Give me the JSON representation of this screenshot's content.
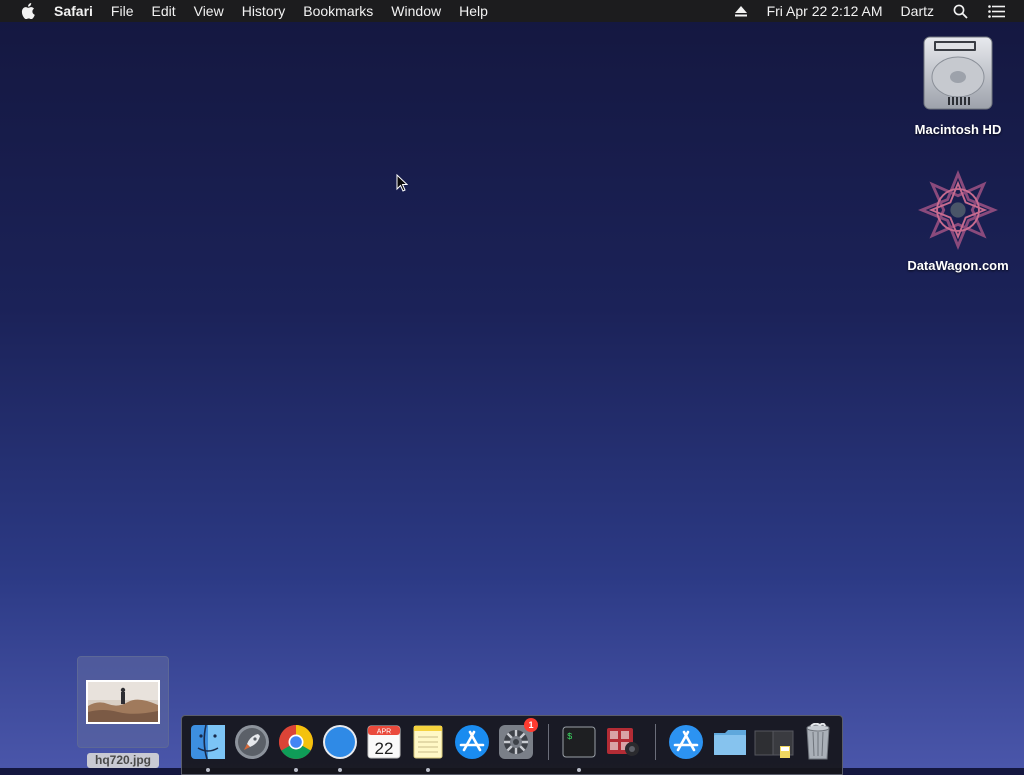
{
  "menubar": {
    "app_name": "Safari",
    "menus": [
      "File",
      "Edit",
      "View",
      "History",
      "Bookmarks",
      "Window",
      "Help"
    ],
    "clock": "Fri Apr 22  2:12 AM",
    "user": "Dartz"
  },
  "desktop": {
    "icons": [
      {
        "label": "Macintosh HD",
        "icon": "hard-drive-icon"
      },
      {
        "label": "DataWagon.com",
        "icon": "datawagon-logo-icon"
      }
    ],
    "file": {
      "label": "hq720.jpg",
      "icon": "image-thumbnail-icon"
    }
  },
  "dock": {
    "items": [
      {
        "name": "finder",
        "icon": "finder-icon",
        "running": true
      },
      {
        "name": "launchpad",
        "icon": "rocket-icon",
        "running": false
      },
      {
        "name": "chrome",
        "icon": "chrome-icon",
        "running": true
      },
      {
        "name": "safari",
        "icon": "compass-icon",
        "running": true
      },
      {
        "name": "calendar",
        "icon": "calendar-icon",
        "running": false,
        "month": "APR",
        "day": "22"
      },
      {
        "name": "notes",
        "icon": "notes-icon",
        "running": true
      },
      {
        "name": "app-store",
        "icon": "app-store-icon",
        "running": false
      },
      {
        "name": "system-preferences",
        "icon": "gear-icon",
        "running": false,
        "badge": "1"
      },
      {
        "name": "terminal",
        "icon": "terminal-icon",
        "running": true,
        "prompt": "$"
      },
      {
        "name": "photo-booth",
        "icon": "photo-booth-icon",
        "running": false
      },
      {
        "name": "applications-folder",
        "icon": "applications-folder-icon",
        "running": false
      },
      {
        "name": "documents-folder",
        "icon": "folder-icon",
        "running": false
      },
      {
        "name": "downloads-stack",
        "icon": "stack-icon",
        "running": false
      },
      {
        "name": "trash",
        "icon": "trash-icon",
        "running": false
      }
    ]
  },
  "colors": {
    "menubar_bg": "#1c1c1e",
    "desktop_top": "#14173f",
    "desktop_bottom": "#4a56aa",
    "badge": "#ff3b30"
  }
}
